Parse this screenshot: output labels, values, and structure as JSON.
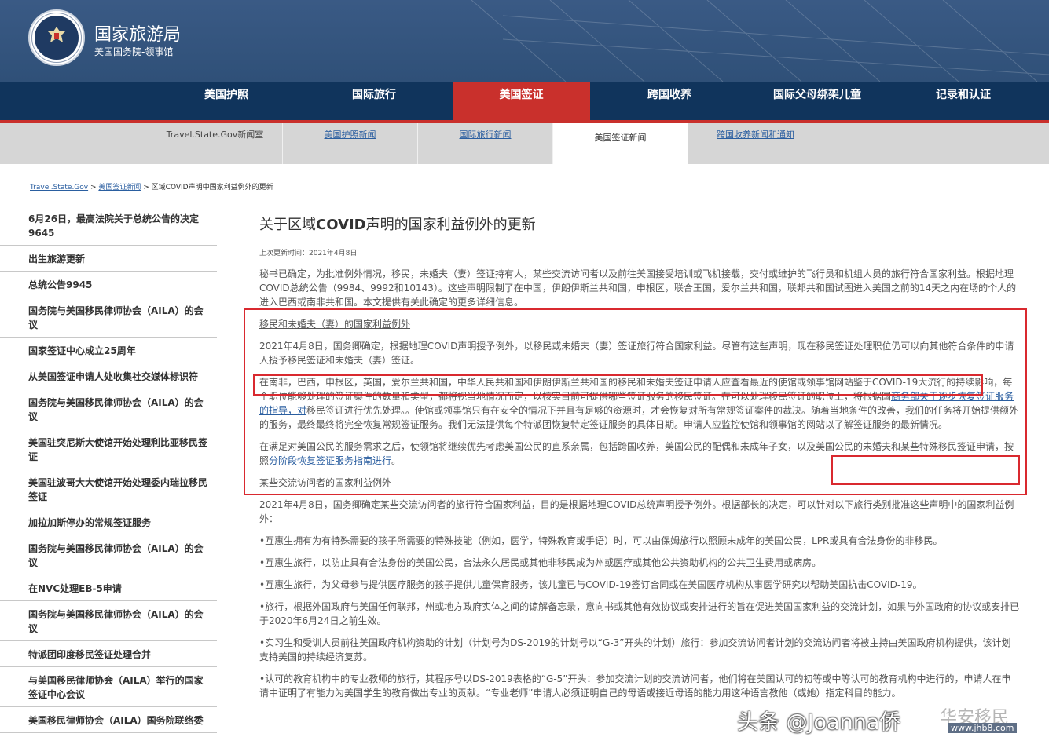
{
  "header": {
    "title": "国家旅游局",
    "subtitle": "美国国务院-领事馆"
  },
  "main_nav": [
    {
      "label": "美国护照"
    },
    {
      "label": "国际旅行"
    },
    {
      "label": "美国签证"
    },
    {
      "label": "跨国收养"
    },
    {
      "label": "国际父母绑架儿童"
    },
    {
      "label": "记录和认证"
    }
  ],
  "sub_nav": [
    {
      "label": "Travel.State.Gov新闻室"
    },
    {
      "label": "美国护照新闻"
    },
    {
      "label": "国际旅行新闻"
    },
    {
      "label": "美国签证新闻"
    },
    {
      "label": "跨国收养新闻和通知"
    }
  ],
  "breadcrumb": {
    "home": "Travel.State.Gov",
    "sep1": " > ",
    "section": "美国签证新闻",
    "sep2": " > ",
    "current": "区域COVID声明中国家利益例外的更新"
  },
  "sidebar": {
    "items": [
      {
        "label": "6月26日，最高法院关于总统公告的决定9645"
      },
      {
        "label": "出生旅游更新"
      },
      {
        "label": "总统公告9945"
      },
      {
        "label": "国务院与美国移民律师协会（AILA）的会议"
      },
      {
        "label": "国家签证中心成立25周年"
      },
      {
        "label": "从美国签证申请人处收集社交媒体标识符"
      },
      {
        "label": "国务院与美国移民律师协会（AILA）的会议"
      },
      {
        "label": "美国驻突尼斯大使馆开始处理利比亚移民签证"
      },
      {
        "label": "美国驻波哥大大使馆开始处理委内瑞拉移民签证"
      },
      {
        "label": "加拉加斯停办的常规签证服务"
      },
      {
        "label": "国务院与美国移民律师协会（AILA）的会议"
      },
      {
        "label": "在NVC处理EB-5申请"
      },
      {
        "label": "国务院与美国移民律师协会（AILA）的会议"
      },
      {
        "label": "特派团印度移民签证处理合并"
      },
      {
        "label": "与美国移民律师协会（AILA）举行的国家签证中心会议"
      },
      {
        "label": "美国移民律师协会（AILA）国务院联络委"
      }
    ]
  },
  "article": {
    "title_a": "关于区域",
    "title_b": "COVID",
    "title_c": "声明的国家利益例外的更新",
    "updated": "上次更新时间：2021年4月8日",
    "intro": "秘书已确定，为批准例外情况，移民，未婚夫（妻）签证持有人，某些交流访问者以及前往美国接受培训或飞机接载，交付或维护的飞行员和机组人员的旅行符合国家利益。根据地理COVID总统公告（9984、9992和10143）。这些声明限制了在中国，伊朗伊斯兰共和国，申根区，联合王国，爱尔兰共和国，联邦共和国试图进入美国之前的14天之内在场的个人的进入巴西或南非共和国。本文提供有关此确定的更多详细信息。",
    "section1_heading": "移民和未婚夫（妻）的国家利益例外",
    "section1_p1": "2021年4月8日，国务卿确定，根据地理COVID声明授予例外，以移民或未婚夫（妻）签证旅行符合国家利益。尽管有这些声明，现在移民签证处理职位仍可以向其他符合条件的申请人授予移民签证和未婚夫（妻）签证。",
    "section1_p2_a": "在南非，巴西，申根区，英国，爱尔兰共和国，中华人民共和国和伊朗伊斯兰共和国的移民和未婚夫签证申请人应查看最近的使馆或领事馆网站鉴于COVID-19大流行的持续影响，每个职位能够处理的签证案件的数量和类型，都将视当地情况而定，以核实目前可提供哪些签证服务的移民签证。在可以处理移民签证的职位上，将根据国",
    "section1_p2_link": "商务部关于逐步恢复签证服务的指导，对",
    "section1_p2_b": "移民签证进行优先处理。。使馆或领事馆只有在安全的情况下并且有足够的资源时，才会恢复对所有常规签证案件的裁决。随着当地条件的改善，我们的任务将开始提供额外的服务，最终最终将完全恢复常规签证服务。我们无法提供每个特派团恢复特定签证服务的具体日期。申请人应监控使馆和领事馆的网站以了解签证服务的最新情况。",
    "section1_p3_a": "在满足对美国公民的服务需求之后，使领馆将继续优先考虑美国公民的直系亲属，包括跨国收养，美国公民的配偶和未成年子女，以及美国公民的未婚夫和某些特殊移民签证申请，按照",
    "section1_p3_link": "分阶段恢复签证服务指南进行",
    "section1_p3_b": "。",
    "section2_heading": "某些交流访问者的国家利益例外",
    "section2_p1": "2021年4月8日，国务卿确定某些交流访问者的旅行符合国家利益，目的是根据地理COVID总统声明授予例外。根据部长的决定，可以针对以下旅行类别批准这些声明中的国家利益例外：",
    "bullets": [
      "•互惠生拥有为有特殊需要的孩子所需要的特殊技能（例如，医学，特殊教育或手语）时，可以由保姆旅行以照顾未成年的美国公民，LPR或具有合法身份的非移民。",
      "•互惠生旅行，以防止具有合法身份的美国公民，合法永久居民或其他非移民成为州或医疗或其他公共资助机构的公共卫生费用或病房。",
      "•互惠生旅行，为父母参与提供医疗服务的孩子提供儿童保育服务，该儿童已与COVID-19签订合同或在美国医疗机构从事医学研究以帮助美国抗击COVID-19。",
      "•旅行，根据外国政府与美国任何联邦，州或地方政府实体之间的谅解备忘录，意向书或其他有效协议或安排进行的旨在促进美国国家利益的交流计划，如果与外国政府的协议或安排已于2020年6月24日之前生效。",
      "•实习生和受训人员前往美国政府机构资助的计划（计划号为DS-2019的计划号以“G-3”开头的计划）旅行：参加交流访问者计划的交流访问者将被主持由美国政府机构提供，该计划支持美国的持续经济复苏。",
      "•认可的教育机构中的专业教师的旅行，其程序号以DS-2019表格的“G-5”开头：参加交流计划的交流访问者，他们将在美国认可的初等或中等认可的教育机构中进行的，申请人在申请中证明了有能力为美国学生的教育做出专业的贡献。“专业老师”申请人必须证明自己的母语或接近母语的能力用这种语言教他（或她）指定科目的能力。"
    ]
  },
  "watermark": {
    "text": "头条 @Joanna侨",
    "brand": "华安移民",
    "url": "www.jhb8.com"
  }
}
